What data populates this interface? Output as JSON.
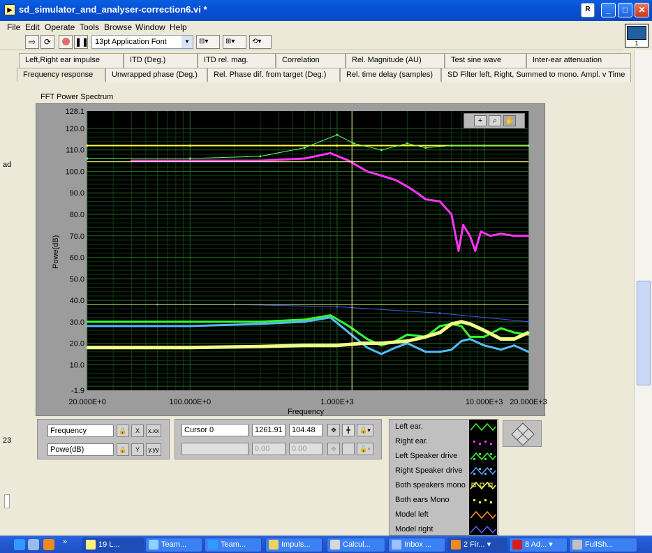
{
  "window": {
    "title": "sd_simulator_and_analyser-correction6.vi *",
    "r_button": "R",
    "min_button": "_",
    "max_button": "□",
    "close_button": "✕",
    "vi_icon_number": "1"
  },
  "menu": [
    "File",
    "Edit",
    "Operate",
    "Tools",
    "Browse",
    "Window",
    "Help"
  ],
  "toolbar": {
    "font": "13pt Application Font"
  },
  "tabs_row1": [
    "Left,Right ear impulse",
    "ITD  (Deg.)",
    "ITD  rel. mag.",
    "Correlation",
    "Rel. Magnitude (AU)",
    "Test sine wave",
    "Inter-ear attenuation"
  ],
  "tabs_row2": [
    "Frequency response",
    "Unwrapped phase (Deg.)",
    "Rel. Phase dif. from target (Deg.)",
    "Rel. time delay (samples)",
    "SD Filter left, Right, Summed to mono. Ampl. v Time"
  ],
  "side": {
    "left_fragment": "ad",
    "left_number": "23"
  },
  "graph": {
    "label": "FFT Power Spectrum",
    "ylabel": "Powe(dB)",
    "xlabel": "Frequency",
    "palette": [
      "+",
      "⌕",
      "✋"
    ]
  },
  "scale_legend": {
    "x_name": "Frequency",
    "y_name": "Powe(dB)",
    "x_btn1": "X",
    "x_btn2": "x.xx",
    "y_btn1": "Y",
    "y_btn2": "y.yy"
  },
  "cursor_legend": {
    "name": "Cursor 0",
    "x_value": "1261.91",
    "y_value": "104.48",
    "x_value2": "0.00",
    "y_value2": "0.00"
  },
  "plot_legend": [
    {
      "name": "Left ear.",
      "color": "#33FF33",
      "style": "line"
    },
    {
      "name": "Right ear.",
      "color": "#FF33FF",
      "style": "dots"
    },
    {
      "name": "Left Speaker drive",
      "color": "#33FF33",
      "style": "line-dots"
    },
    {
      "name": "Right Speaker drive",
      "color": "#55AAFF",
      "style": "line-dots"
    },
    {
      "name": "Both speakers mono",
      "color": "#FFFF66",
      "style": "line-squares"
    },
    {
      "name": "Both ears Mono",
      "color": "#FFFF33",
      "style": "dots"
    },
    {
      "name": "Model left",
      "color": "#FF9933",
      "style": "line"
    },
    {
      "name": "Model right",
      "color": "#5566FF",
      "style": "line"
    }
  ],
  "chart_data": {
    "type": "line",
    "title": "FFT Power Spectrum",
    "xlabel": "Frequency",
    "ylabel": "Powe(dB)",
    "x_scale": "log",
    "xlim": [
      20,
      20000
    ],
    "ylim": [
      -1.9,
      128.1
    ],
    "x_ticks": [
      "20.000E+0",
      "100.000E+0",
      "1.000E+3",
      "10.000E+3",
      "20.000E+3"
    ],
    "y_ticks": [
      "128.1",
      "120.0",
      "110.0",
      "100.0",
      "90.0",
      "80.0",
      "70.0",
      "60.0",
      "50.0",
      "40.0",
      "30.0",
      "20.0",
      "10.0",
      "-1.9"
    ],
    "grid": true,
    "cursor": {
      "x": 1261.91,
      "y": 104.48
    },
    "series": [
      {
        "name": "Right ear.",
        "color": "#FF33FF",
        "x": [
          40,
          100,
          300,
          600,
          900,
          1200,
          1600,
          2000,
          2500,
          3000,
          3500,
          4000,
          5000,
          6000,
          6700,
          7200,
          8000,
          8700,
          9500,
          11000,
          13000,
          16000,
          20000
        ],
        "y": [
          105,
          105,
          105,
          106,
          108.5,
          105,
          100,
          98,
          96,
          93,
          90,
          87,
          86,
          80,
          63,
          75,
          70,
          63,
          72,
          70,
          71,
          70,
          70
        ]
      },
      {
        "name": "Both ears Mono",
        "color": "#FFFF33",
        "x": [
          20,
          100,
          1000,
          10000,
          20000
        ],
        "y": [
          112,
          112,
          112,
          112,
          112
        ]
      },
      {
        "name": "Left ear.",
        "color": "#66FF66",
        "x": [
          20,
          100,
          300,
          600,
          1000,
          1300,
          2000,
          3000,
          4000,
          6000,
          10000,
          20000
        ],
        "y": [
          106,
          106,
          107,
          111,
          117,
          113,
          110,
          113,
          111,
          112,
          112,
          112
        ]
      },
      {
        "name": "Left Speaker drive",
        "color": "#33FF33",
        "x": [
          20,
          100,
          300,
          600,
          900,
          1200,
          1600,
          2000,
          2500,
          3000,
          4000,
          5000,
          6000,
          7000,
          8000,
          10000,
          13000,
          16000,
          20000
        ],
        "y": [
          30,
          30,
          30,
          31,
          33,
          28,
          22,
          19,
          21,
          24,
          23,
          28,
          29,
          28,
          23,
          23,
          27,
          25,
          24
        ]
      },
      {
        "name": "Right Speaker drive",
        "color": "#55BBFF",
        "x": [
          20,
          100,
          300,
          600,
          900,
          1200,
          1600,
          2000,
          2500,
          3000,
          4000,
          5000,
          6000,
          7000,
          8000,
          10000,
          13000,
          16000,
          20000
        ],
        "y": [
          28,
          28,
          29,
          30,
          32,
          25,
          18,
          15,
          18,
          20,
          16,
          16,
          17,
          21,
          22,
          19,
          17,
          19,
          16
        ]
      },
      {
        "name": "Both speakers mono",
        "color": "#EEFF88",
        "x": [
          20,
          100,
          300,
          600,
          1000,
          1500,
          2000,
          3000,
          4000,
          5000,
          6000,
          7000,
          8000,
          10000,
          13000,
          16000,
          20000
        ],
        "y": [
          18,
          18,
          18.5,
          19,
          19,
          20,
          20,
          21,
          23,
          25,
          29,
          30,
          29,
          26,
          22,
          22,
          25
        ]
      },
      {
        "name": "Model right",
        "color": "#4455EE",
        "x": [
          60,
          200,
          1000,
          5000,
          20000
        ],
        "y": [
          38,
          38,
          37,
          34,
          30
        ]
      }
    ]
  }
}
